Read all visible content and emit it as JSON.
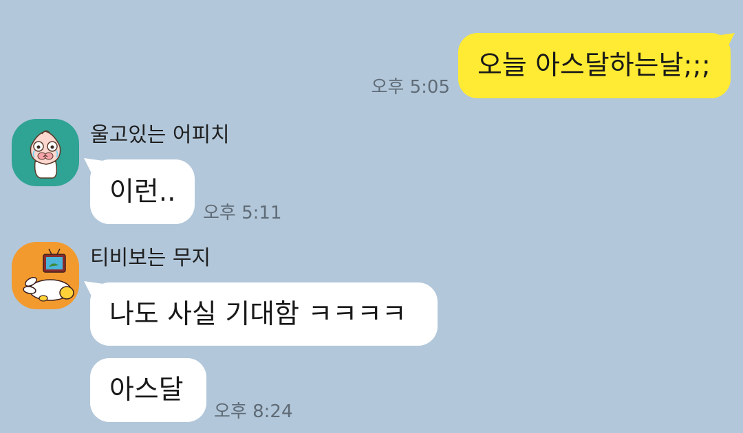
{
  "messages": {
    "sent": {
      "text": "오늘 아스달하는날;;;",
      "time": "오후 5:05"
    },
    "peach": {
      "sender": "울고있는 어피치",
      "avatar_icon": "crying-apeach-icon",
      "avatar_color": "#2fa394",
      "text": "이런..",
      "time": "오후 5:11"
    },
    "muzi": {
      "sender": "티비보는 무지",
      "avatar_icon": "tv-watching-muzi-icon",
      "avatar_color": "#f39a2e",
      "text1": "나도 사실 기대함 ㅋㅋㅋㅋ",
      "text2": "아스달",
      "time": "오후 8:24"
    }
  },
  "colors": {
    "background": "#b2c7da",
    "my_bubble": "#ffeb33",
    "other_bubble": "#ffffff"
  }
}
